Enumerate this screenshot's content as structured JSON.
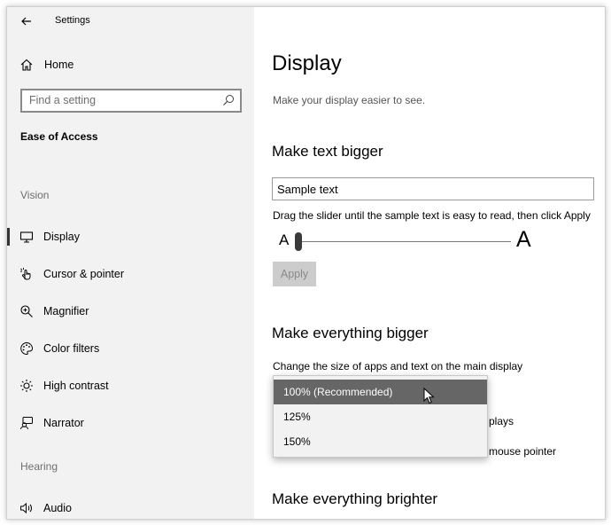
{
  "window": {
    "title": "Settings"
  },
  "sidebar": {
    "home_label": "Home",
    "search_placeholder": "Find a setting",
    "category": "Ease of Access",
    "groups": [
      {
        "label": "Vision"
      },
      {
        "label": "Hearing"
      }
    ],
    "items": [
      {
        "label": "Display",
        "icon": "monitor-icon",
        "active": true
      },
      {
        "label": "Cursor & pointer",
        "icon": "pointer-icon"
      },
      {
        "label": "Magnifier",
        "icon": "magnifier-icon"
      },
      {
        "label": "Color filters",
        "icon": "color-filters-icon"
      },
      {
        "label": "High contrast",
        "icon": "high-contrast-icon"
      },
      {
        "label": "Narrator",
        "icon": "narrator-icon"
      },
      {
        "label": "Audio",
        "icon": "speaker-icon"
      }
    ]
  },
  "main": {
    "title": "Display",
    "subtitle": "Make your display easier to see.",
    "text_bigger": {
      "heading": "Make text bigger",
      "sample_value": "Sample text",
      "hint": "Drag the slider until the sample text is easy to read, then click Apply",
      "slider_small_label": "A",
      "slider_large_label": "A",
      "slider_value_fraction": 0.0,
      "apply_label": "Apply"
    },
    "everything_bigger": {
      "heading": "Make everything bigger",
      "description": "Change the size of apps and text on the main display",
      "options": [
        "100% (Recommended)",
        "125%",
        "150%"
      ],
      "selected": "100% (Recommended)",
      "partial_text_1": "plays",
      "partial_text_2": "mouse pointer"
    },
    "brighter": {
      "heading": "Make everything brighter"
    }
  }
}
